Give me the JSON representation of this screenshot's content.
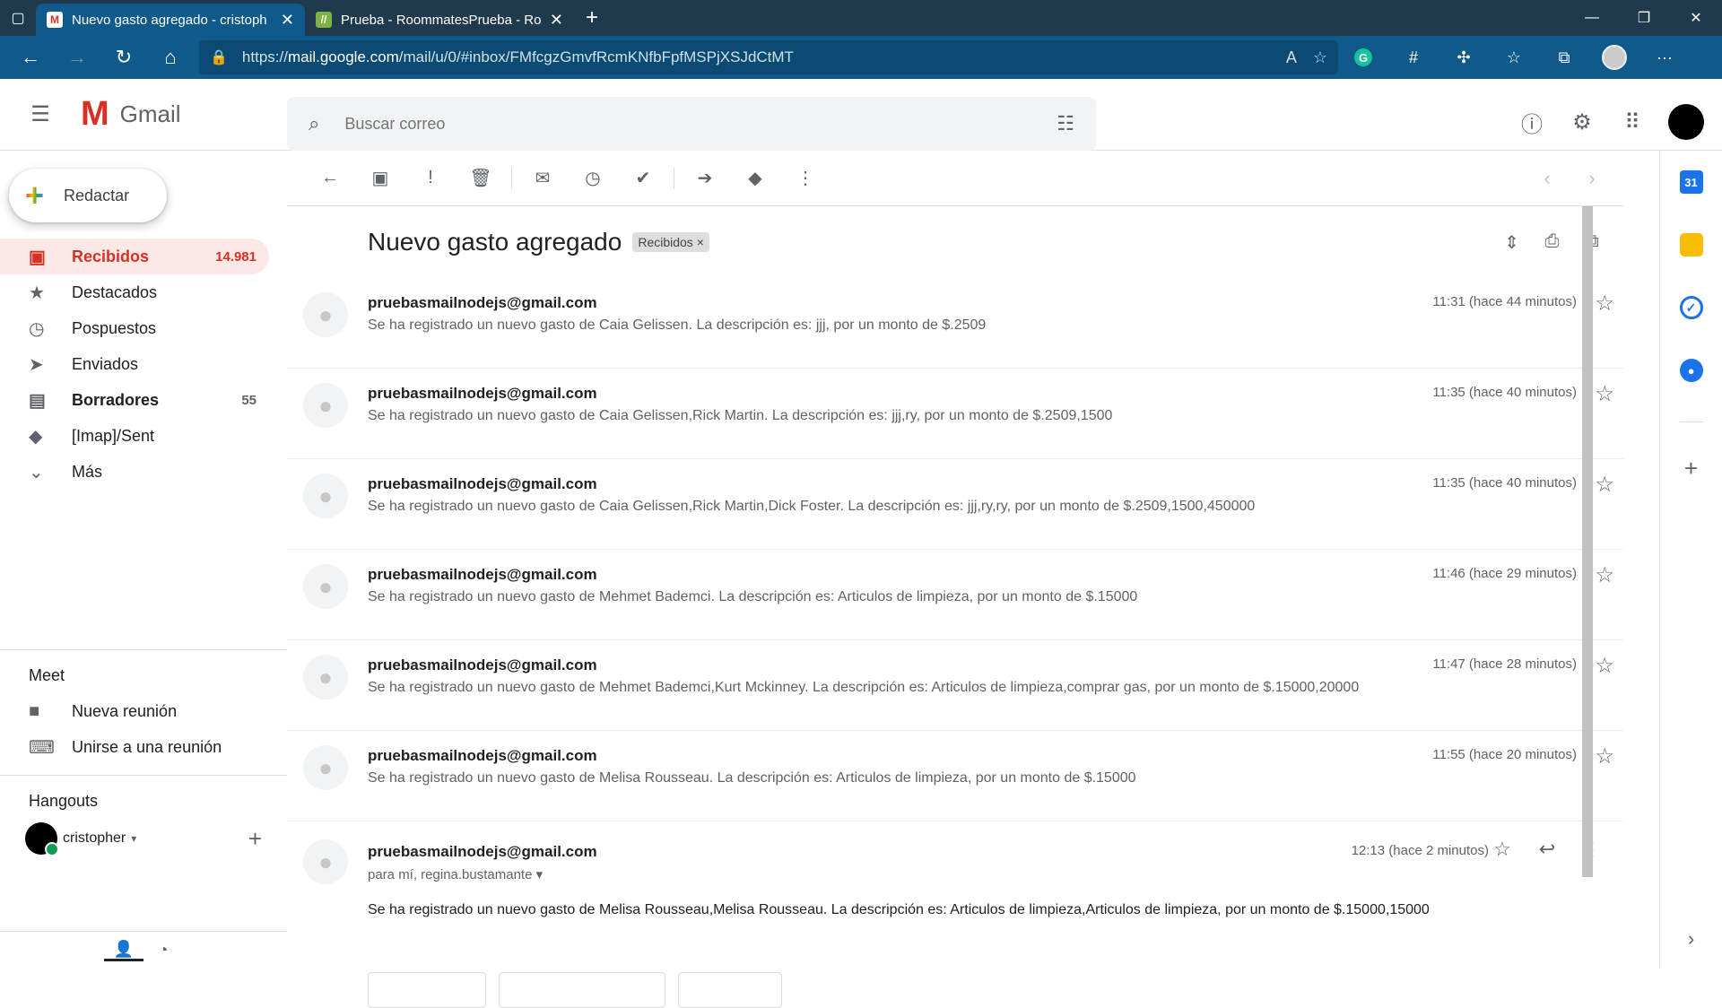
{
  "browser": {
    "tabs": [
      {
        "title": "Nuevo gasto agregado - cristoph",
        "favicon": "M",
        "active": true
      },
      {
        "title": "Prueba - RoommatesPrueba - Ro",
        "favicon": "//",
        "active": false
      }
    ],
    "url_prefix": "https://",
    "url_host": "mail.google.com",
    "url_path": "/mail/u/0/#inbox/FMfcgzGmvfRcmKNfbFpfMSPjXSJdCtMT"
  },
  "gmail": {
    "brand": "Gmail",
    "search_placeholder": "Buscar correo"
  },
  "nav": {
    "compose_label": "Redactar",
    "items": [
      {
        "label": "Recibidos",
        "count": "14.981",
        "icon": "inbox-icon"
      },
      {
        "label": "Destacados",
        "count": "",
        "icon": "star-icon"
      },
      {
        "label": "Pospuestos",
        "count": "",
        "icon": "clock-icon"
      },
      {
        "label": "Enviados",
        "count": "",
        "icon": "send-icon"
      },
      {
        "label": "Borradores",
        "count": "55",
        "icon": "draft-icon"
      },
      {
        "label": "[Imap]/Sent",
        "count": "",
        "icon": "label-icon"
      },
      {
        "label": "Más",
        "count": "",
        "icon": "chevron-down-icon"
      }
    ]
  },
  "meet": {
    "title": "Meet",
    "new_meeting": "Nueva reunión",
    "join_meeting": "Unirse a una reunión"
  },
  "hangouts": {
    "title": "Hangouts",
    "user": "cristopher"
  },
  "thread": {
    "subject": "Nuevo gasto agregado",
    "label_chip": "Recibidos",
    "messages": [
      {
        "from": "pruebasmailnodejs@gmail.com",
        "snippet": "Se ha registrado un nuevo gasto de Caia Gelissen. La descripción es: jjj, por un monto de $.2509",
        "time": "11:31 (hace 44 minutos)"
      },
      {
        "from": "pruebasmailnodejs@gmail.com",
        "snippet": "Se ha registrado un nuevo gasto de Caia Gelissen,Rick Martin. La descripción es: jjj,ry, por un monto de $.2509,1500",
        "time": "11:35 (hace 40 minutos)"
      },
      {
        "from": "pruebasmailnodejs@gmail.com",
        "snippet": "Se ha registrado un nuevo gasto de Caia Gelissen,Rick Martin,Dick Foster. La descripción es: jjj,ry,ry, por un monto de $.2509,1500,450000",
        "time": "11:35 (hace 40 minutos)"
      },
      {
        "from": "pruebasmailnodejs@gmail.com",
        "snippet": "Se ha registrado un nuevo gasto de Mehmet Bademci. La descripción es: Articulos de limpieza, por un monto de $.15000",
        "time": "11:46 (hace 29 minutos)"
      },
      {
        "from": "pruebasmailnodejs@gmail.com",
        "snippet": "Se ha registrado un nuevo gasto de Mehmet Bademci,Kurt Mckinney. La descripción es: Articulos de limpieza,comprar gas, por un monto de $.15000,20000",
        "time": "11:47 (hace 28 minutos)"
      },
      {
        "from": "pruebasmailnodejs@gmail.com",
        "snippet": "Se ha registrado un nuevo gasto de Melisa Rousseau. La descripción es: Articulos de limpieza, por un monto de $.15000",
        "time": "11:55 (hace 20 minutos)"
      }
    ],
    "expanded": {
      "from": "pruebasmailnodejs@gmail.com",
      "to": "para mí, regina.bustamante",
      "time": "12:13 (hace 2 minutos)",
      "content": "Se ha registrado un nuevo gasto de Melisa Rousseau,Melisa Rousseau. La descripción es: Articulos de limpieza,Articulos de limpieza, por un monto de $.15000,15000"
    }
  },
  "side_panel": {
    "calendar_day": "31"
  },
  "colors": {
    "accent_red": "#d93025",
    "chrome_tabbar": "#1f3a4d",
    "chrome_addr": "#0f5a8a"
  }
}
